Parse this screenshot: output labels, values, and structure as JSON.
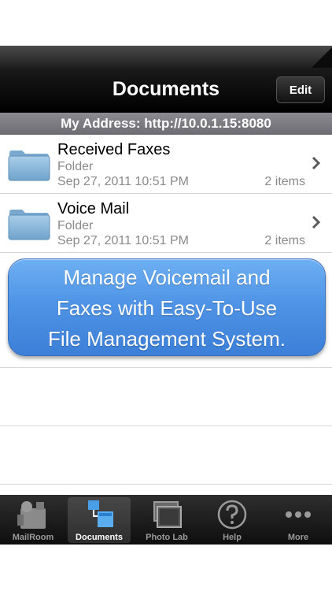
{
  "navbar": {
    "title": "Documents",
    "edit_label": "Edit"
  },
  "address_bar": {
    "text": "My Address: http://10.0.1.15:8080"
  },
  "files": [
    {
      "name": "Received Faxes",
      "kind": "Folder",
      "date": "Sep 27, 2011 10:51 PM",
      "count": "2 items"
    },
    {
      "name": "Voice Mail",
      "kind": "Folder",
      "date": "Sep 27, 2011 10:51 PM",
      "count": "2 items"
    }
  ],
  "promo": {
    "line1": "Manage Voicemail and",
    "line2": "Faxes with Easy-To-Use",
    "line3": "File Management System."
  },
  "tabs": [
    {
      "label": "MailRoom",
      "icon": "mailroom-icon"
    },
    {
      "label": "Documents",
      "icon": "documents-icon",
      "active": true
    },
    {
      "label": "Photo Lab",
      "icon": "photo-lab-icon"
    },
    {
      "label": "Help",
      "icon": "help-icon"
    },
    {
      "label": "More",
      "icon": "more-icon"
    }
  ],
  "colors": {
    "promo_blue": "#4f94e6",
    "address_bar": "#7b7b81",
    "navbar": "#0d0d0d"
  }
}
